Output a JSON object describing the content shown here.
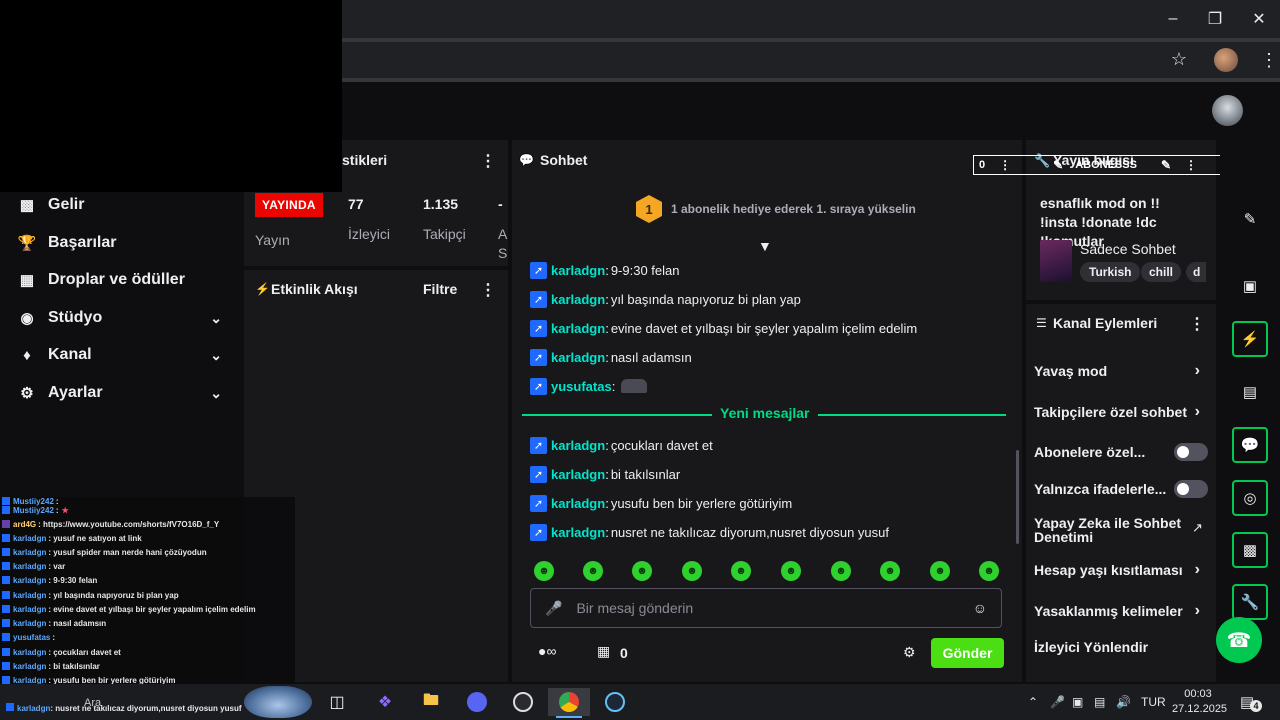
{
  "sidebar": {
    "items": [
      {
        "label": "Gelir",
        "icon": "bar-chart-icon",
        "expandable": false
      },
      {
        "label": "Başarılar",
        "icon": "trophy-icon",
        "expandable": false
      },
      {
        "label": "Droplar ve ödüller",
        "icon": "gift-icon",
        "expandable": false
      },
      {
        "label": "Stüdyo",
        "icon": "studio-icon",
        "expandable": true
      },
      {
        "label": "Kanal",
        "icon": "channel-icon",
        "expandable": true
      },
      {
        "label": "Ayarlar",
        "icon": "gear-icon",
        "expandable": true
      }
    ]
  },
  "stats": {
    "title_partial": "stikleri",
    "live_label": "YAYINDA",
    "live_sub": "Yayın",
    "viewers_value": "77",
    "viewers_label": "İzleyici",
    "followers_value": "1.135",
    "followers_label": "Takipçi",
    "cut_value": "-",
    "cut_label_1": "A",
    "cut_label_2": "S"
  },
  "events": {
    "title": "Etkinlik Akışı",
    "filter_label": "Filtre"
  },
  "chat": {
    "title": "Sohbet",
    "hype_rank": "1",
    "hype_text": "1 abonelik hediye ederek 1. sıraya yükselin",
    "messages_before": [
      {
        "user": "karladgn",
        "text": "9-9:30 felan"
      },
      {
        "user": "karladgn",
        "text": "yıl başında napıyoruz bi plan yap"
      },
      {
        "user": "karladgn",
        "text": "evine davet et yılbaşı bir şeyler yapalım içelim edelim"
      },
      {
        "user": "karladgn",
        "text": "nasıl adamsın"
      },
      {
        "user": "yusufatas",
        "text": ""
      }
    ],
    "new_messages_label": "Yeni mesajlar",
    "messages_after": [
      {
        "user": "karladgn",
        "text": "çocukları davet et"
      },
      {
        "user": "karladgn",
        "text": "bi takılsınlar"
      },
      {
        "user": "karladgn",
        "text": "yusufu ben bir yerlere götüriyim"
      },
      {
        "user": "karladgn",
        "text": "nusret ne takılıcaz diyorum,nusret diyosun yusuf"
      }
    ],
    "input_placeholder": "Bir mesaj gönderin",
    "points_value": "0",
    "send_label": "Gönder",
    "colors": {
      "username": "#00e5cb",
      "new_messages": "#00db84"
    }
  },
  "stream_info": {
    "title": "Yayın bilgisi",
    "stream_title": "esnaflık mod on !! !insta !donate !dc !komutlar",
    "category": "Sadece Sohbet",
    "tags": [
      "Turkish",
      "chill",
      "d"
    ]
  },
  "overlay_bar": {
    "left_count": "0",
    "label": "ABONESSS",
    "right_count": "6"
  },
  "channel_actions": {
    "title": "Kanal Eylemleri",
    "items": [
      {
        "label": "Yavaş mod",
        "kind": "chevron"
      },
      {
        "label": "Takipçilere özel sohbet",
        "kind": "chevron"
      },
      {
        "label": "Abonelere özel...",
        "kind": "toggle"
      },
      {
        "label": "Yalnızca ifadelerle...",
        "kind": "toggle"
      },
      {
        "label": "Yapay Zeka ile Sohbet Denetimi",
        "kind": "external"
      },
      {
        "label": "Hesap yaşı kısıtlaması",
        "kind": "chevron"
      },
      {
        "label": "Yasaklanmış kelimeler",
        "kind": "chevron"
      },
      {
        "label": "İzleyici Yönlendir",
        "kind": "none"
      }
    ]
  },
  "mini_chat": [
    {
      "user": "Mustiiy242",
      "text": ":"
    },
    {
      "user": "Mustiiy242",
      "text": ":"
    },
    {
      "user": "ard4G",
      "text": ": https://www.youtube.com/shorts/fV7O16D_f_Y"
    },
    {
      "user": "karladgn",
      "text": ": yusuf ne satıyon at link"
    },
    {
      "user": "karladgn",
      "text": ": yusuf spider man nerde hani çözüyodun"
    },
    {
      "user": "karladgn",
      "text": ": var"
    },
    {
      "user": "karladgn",
      "text": ": 9-9:30 felan"
    },
    {
      "user": "karladgn",
      "text": ": yıl başında napıyoruz bi plan yap"
    },
    {
      "user": "karladgn",
      "text": ": evine davet et yılbaşı bir şeyler yapalım içelim edelim"
    },
    {
      "user": "karladgn",
      "text": ": nasıl adamsın"
    },
    {
      "user": "yusufatas",
      "text": ":"
    },
    {
      "user": "karladgn",
      "text": ": çocukları davet et"
    },
    {
      "user": "karladgn",
      "text": ": bi takılsınlar"
    },
    {
      "user": "karladgn",
      "text": ": yusufu ben bir yerlere götüriyim"
    },
    {
      "user": "karladgn",
      "text": ": nusret ne takılıcaz diyorum,nusret diyosun yusuf"
    }
  ],
  "taskbar": {
    "language": "TUR",
    "time": "00:03",
    "date": "27.12.2025",
    "notifications": "4",
    "partial_text": "Ara"
  }
}
